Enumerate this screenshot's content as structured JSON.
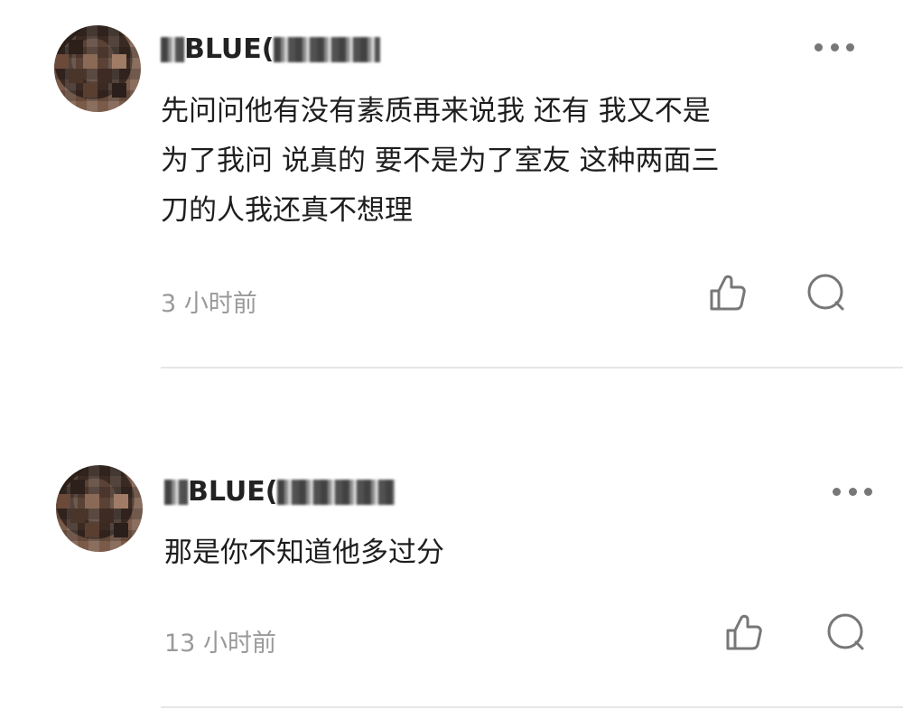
{
  "comments": [
    {
      "username_visible": "BLUE(",
      "text": "先问问他有没有素质再来说我 还有 我又不是\n为了我问 说真的 要不是为了室友 这种两面三\n刀的人我还真不想理",
      "time": "3 小时前"
    },
    {
      "username_visible": "BLUE(",
      "text": "那是你不知道他多过分",
      "time": "13 小时前"
    }
  ],
  "icons": {
    "more": "more-horizontal-icon",
    "like": "thumbs-up-icon",
    "reply": "comment-bubble-icon"
  },
  "colors": {
    "text": "#1e1e1e",
    "meta": "#9a9a9a",
    "icon": "#777777",
    "divider": "#e6e6e6"
  }
}
